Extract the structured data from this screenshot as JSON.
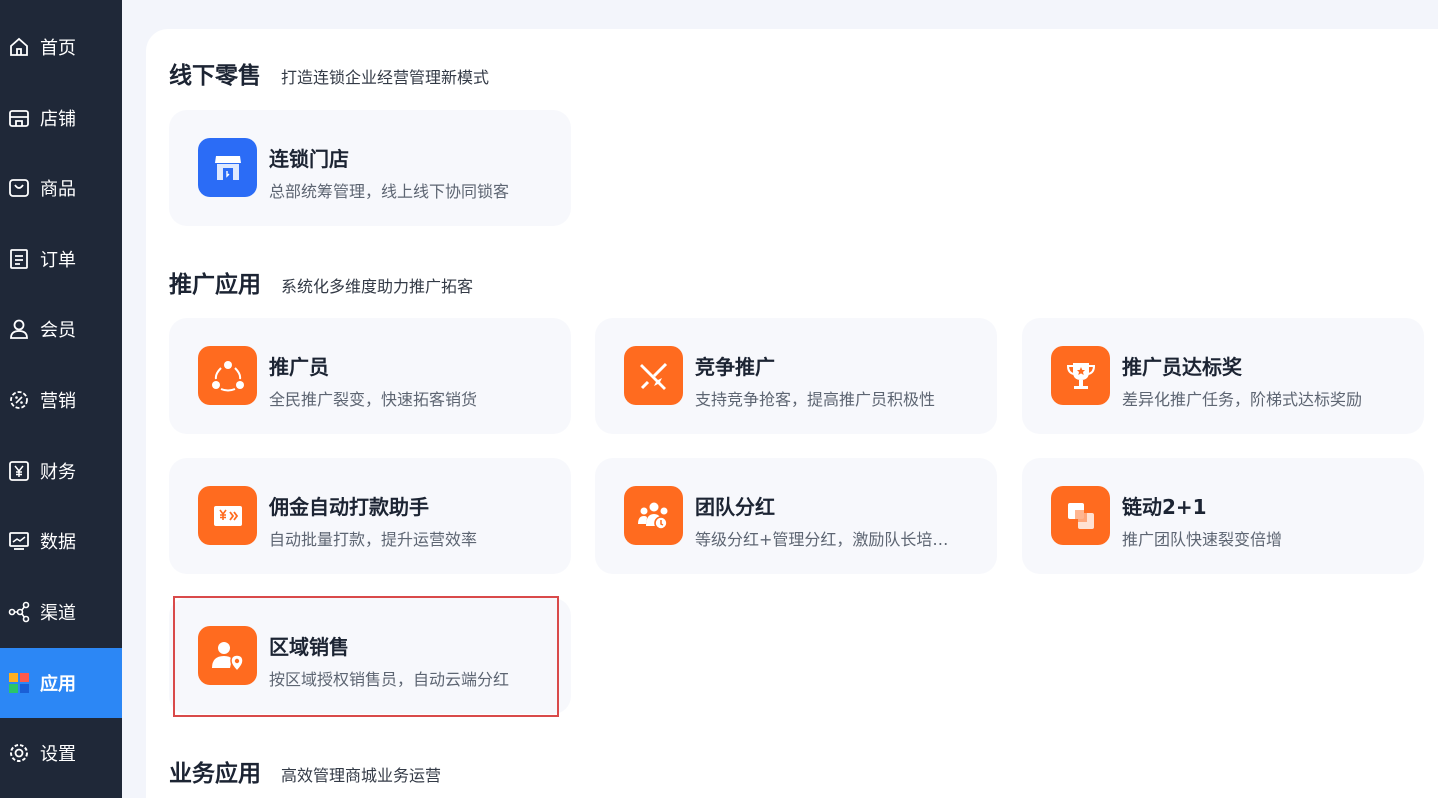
{
  "sidebar": {
    "items": [
      {
        "label": "首页",
        "icon": "home-icon"
      },
      {
        "label": "店铺",
        "icon": "store-icon"
      },
      {
        "label": "商品",
        "icon": "bag-icon"
      },
      {
        "label": "订单",
        "icon": "order-icon"
      },
      {
        "label": "会员",
        "icon": "user-icon"
      },
      {
        "label": "营销",
        "icon": "gear-marketing-icon"
      },
      {
        "label": "财务",
        "icon": "yen-icon"
      },
      {
        "label": "数据",
        "icon": "monitor-icon"
      },
      {
        "label": "渠道",
        "icon": "share-icon"
      },
      {
        "label": "应用",
        "icon": "apps-icon",
        "active": true
      },
      {
        "label": "设置",
        "icon": "settings-icon"
      }
    ]
  },
  "sections": {
    "offline": {
      "title": "线下零售",
      "subtitle": "打造连锁企业经营管理新模式",
      "cards": [
        {
          "title": "连锁门店",
          "desc": "总部统筹管理，线上线下协同锁客",
          "icon": "store-front-icon"
        }
      ]
    },
    "promotion": {
      "title": "推广应用",
      "subtitle": "系统化多维度助力推广拓客",
      "cards": [
        {
          "title": "推广员",
          "desc": "全民推广裂变，快速拓客销货",
          "icon": "network-icon"
        },
        {
          "title": "竞争推广",
          "desc": "支持竞争抢客，提高推广员积极性",
          "icon": "swords-icon"
        },
        {
          "title": "推广员达标奖",
          "desc": "差异化推广任务，阶梯式达标奖励",
          "icon": "trophy-icon"
        },
        {
          "title": "佣金自动打款助手",
          "desc": "自动批量打款，提升运营效率",
          "icon": "payment-icon"
        },
        {
          "title": "团队分红",
          "desc": "等级分红+管理分红，激励队长培…",
          "icon": "team-icon"
        },
        {
          "title": "链动2+1",
          "desc": "推广团队快速裂变倍增",
          "icon": "chain-icon"
        },
        {
          "title": "区域销售",
          "desc": "按区域授权销售员，自动云端分红",
          "icon": "user-location-icon"
        }
      ]
    },
    "business": {
      "title": "业务应用",
      "subtitle": "高效管理商城业务运营"
    }
  },
  "colors": {
    "sidebar_bg": "#1f2838",
    "active_bg": "#2c87f5",
    "icon_orange": "#ff6b1f",
    "icon_blue": "#2b6cf6",
    "highlight_border": "#d94a4a"
  }
}
